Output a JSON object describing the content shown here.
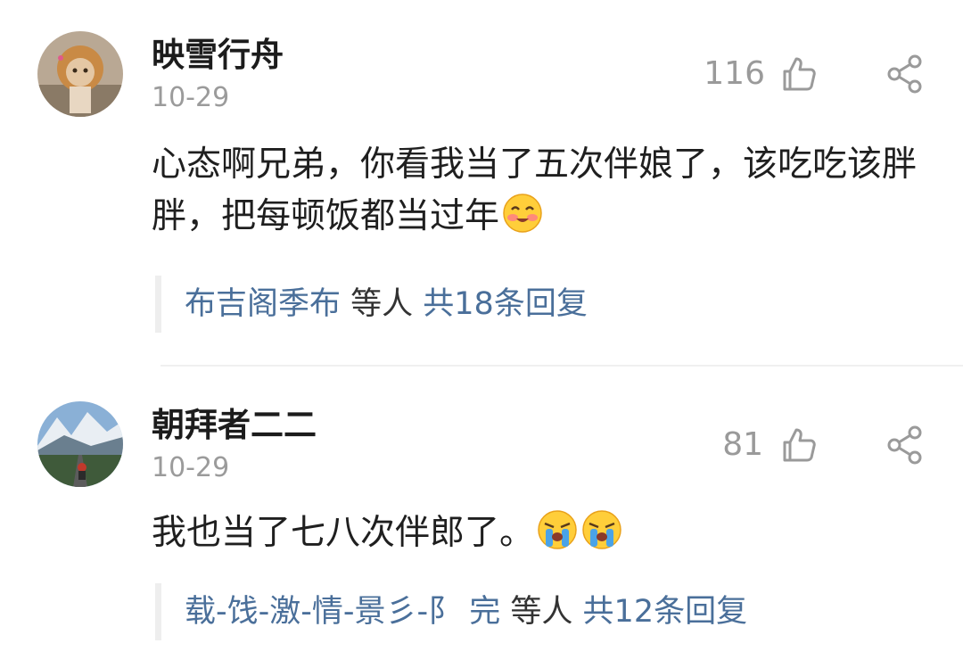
{
  "comments": [
    {
      "username": "映雪行舟",
      "date": "10-29",
      "likes": "116",
      "text": "心态啊兄弟，你看我当了五次伴娘了，该吃吃该胖胖，把每顿饭都当过年",
      "text_emoji": "smiling-blush-face",
      "reply_names": "布吉阁季布",
      "reply_mid": " 等人 ",
      "reply_count": "共18条回复"
    },
    {
      "username": "朝拜者二二",
      "date": "10-29",
      "likes": "81",
      "text": "我也当了七八次伴郎了。",
      "text_emoji": "loudly-crying-face",
      "reply_names": "载-饯-激-情-景彡-阝 完",
      "reply_mid": " 等人 ",
      "reply_count": "共12条回复"
    }
  ],
  "icons": {
    "like": "thumbs-up-outline-icon",
    "share": "share-nodes-icon"
  },
  "colors": {
    "link": "#4a6f9a",
    "muted": "#9a9a9a",
    "divider": "#f0f0f0"
  }
}
